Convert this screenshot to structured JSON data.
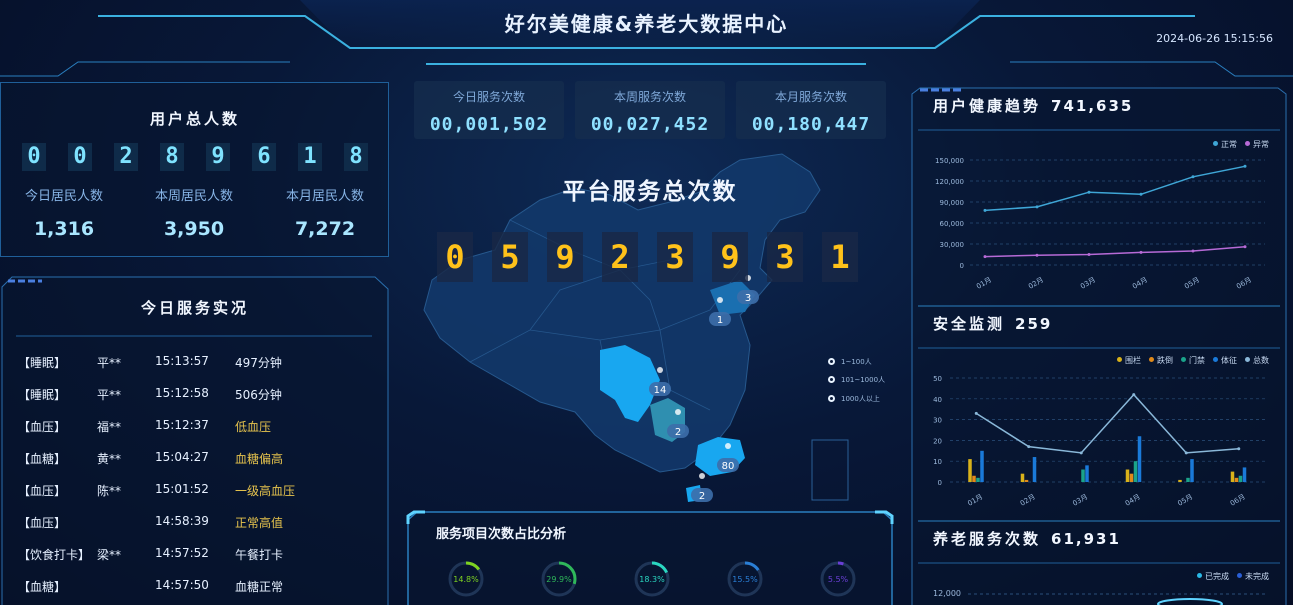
{
  "header": {
    "title": "好尔美健康&养老大数据中心",
    "datetime": "2024-06-26 15:15:56"
  },
  "user_total": {
    "title": "用户总人数",
    "digits": [
      "0",
      "0",
      "2",
      "8",
      "9",
      "6",
      "1",
      "8"
    ],
    "stats": [
      {
        "label": "今日居民人数",
        "value": "1,316"
      },
      {
        "label": "本周居民人数",
        "value": "3,950"
      },
      {
        "label": "本月居民人数",
        "value": "7,272"
      }
    ]
  },
  "service_live": {
    "title": "今日服务实况",
    "rows": [
      {
        "type": "【睡眠】",
        "name": "平**",
        "time": "15:13:57",
        "result": "497分钟",
        "warn": false
      },
      {
        "type": "【睡眠】",
        "name": "平**",
        "time": "15:12:58",
        "result": "506分钟",
        "warn": false
      },
      {
        "type": "【血压】",
        "name": "福**",
        "time": "15:12:37",
        "result": "低血压",
        "warn": true
      },
      {
        "type": "【血糖】",
        "name": "黄**",
        "time": "15:04:27",
        "result": "血糖偏高",
        "warn": true
      },
      {
        "type": "【血压】",
        "name": "陈**",
        "time": "15:01:52",
        "result": "一级高血压",
        "warn": true
      },
      {
        "type": "【血压】",
        "name": "",
        "time": "14:58:39",
        "result": "正常高值",
        "warn": true
      },
      {
        "type": "【饮食打卡】",
        "name": "梁**",
        "time": "14:57:52",
        "result": "午餐打卡",
        "warn": false
      },
      {
        "type": "【血糖】",
        "name": "",
        "time": "14:57:50",
        "result": "血糖正常",
        "warn": false
      }
    ]
  },
  "counters": [
    {
      "label": "今日服务次数",
      "value": "00,001,502"
    },
    {
      "label": "本周服务次数",
      "value": "00,027,452"
    },
    {
      "label": "本月服务次数",
      "value": "00,180,447"
    }
  ],
  "platform": {
    "title": "平台服务总次数",
    "digits": [
      "0",
      "5",
      "9",
      "2",
      "3",
      "9",
      "3",
      "1"
    ]
  },
  "map": {
    "markers": [
      "3",
      "1",
      "14",
      "2",
      "80",
      "2"
    ],
    "legend": [
      "1~100人",
      "101~1000人",
      "1000人以上"
    ]
  },
  "analysis": {
    "title": "服务项目次数占比分析",
    "gauges": [
      {
        "label": "14.8%",
        "value": 14.8,
        "color": "#7ed321"
      },
      {
        "label": "29.9%",
        "value": 29.9,
        "color": "#2fb85a"
      },
      {
        "label": "18.3%",
        "value": 18.3,
        "color": "#2ad6c0"
      },
      {
        "label": "15.5%",
        "value": 15.5,
        "color": "#2a7fd6"
      },
      {
        "label": "5.5%",
        "value": 5.5,
        "color": "#6a3fd6"
      }
    ]
  },
  "health_trend": {
    "title": "用户健康趋势",
    "total": "741,635",
    "colors": {
      "正常": "#3fa6d6",
      "异常": "#b76ad6"
    },
    "chart_data": {
      "type": "line",
      "categories": [
        "01月",
        "02月",
        "03月",
        "04月",
        "05月",
        "06月"
      ],
      "series": [
        {
          "name": "正常",
          "values": [
            78000,
            83000,
            104000,
            101000,
            126000,
            141000
          ]
        },
        {
          "name": "异常",
          "values": [
            12000,
            14000,
            15000,
            18000,
            20000,
            26000
          ]
        }
      ],
      "yticks": [
        "150,000",
        "120,000",
        "90,000",
        "60,000",
        "30,000",
        "0"
      ],
      "ylim": [
        0,
        150000
      ]
    }
  },
  "safety": {
    "title": "安全监测",
    "total": "259",
    "colors": {
      "围栏": "#d9b21a",
      "跌倒": "#e08a1a",
      "门禁": "#1aa38a",
      "体征": "#1a7ad9",
      "总数": "#8ab8d9"
    },
    "chart_data": {
      "type": "bar",
      "categories": [
        "01月",
        "02月",
        "03月",
        "04月",
        "05月",
        "06月"
      ],
      "series": [
        {
          "name": "围栏",
          "values": [
            11,
            4,
            0,
            6,
            1,
            5
          ]
        },
        {
          "name": "跌倒",
          "values": [
            3,
            1,
            0,
            4,
            0,
            2
          ]
        },
        {
          "name": "门禁",
          "values": [
            2,
            0,
            6,
            10,
            2,
            3
          ]
        },
        {
          "name": "体征",
          "values": [
            15,
            12,
            8,
            22,
            11,
            7
          ]
        },
        {
          "name": "总数",
          "values": [
            33,
            17,
            14,
            42,
            14,
            16
          ]
        }
      ],
      "yticks": [
        "50",
        "40",
        "30",
        "20",
        "10",
        "0"
      ],
      "ylim": [
        0,
        50
      ]
    }
  },
  "elderly_service": {
    "title": "养老服务次数",
    "total": "61,931",
    "legend": [
      "已完成",
      "未完成"
    ],
    "colors": {
      "已完成": "#2ab8e6",
      "未完成": "#2a5fd6"
    },
    "ytick": "12,000"
  }
}
